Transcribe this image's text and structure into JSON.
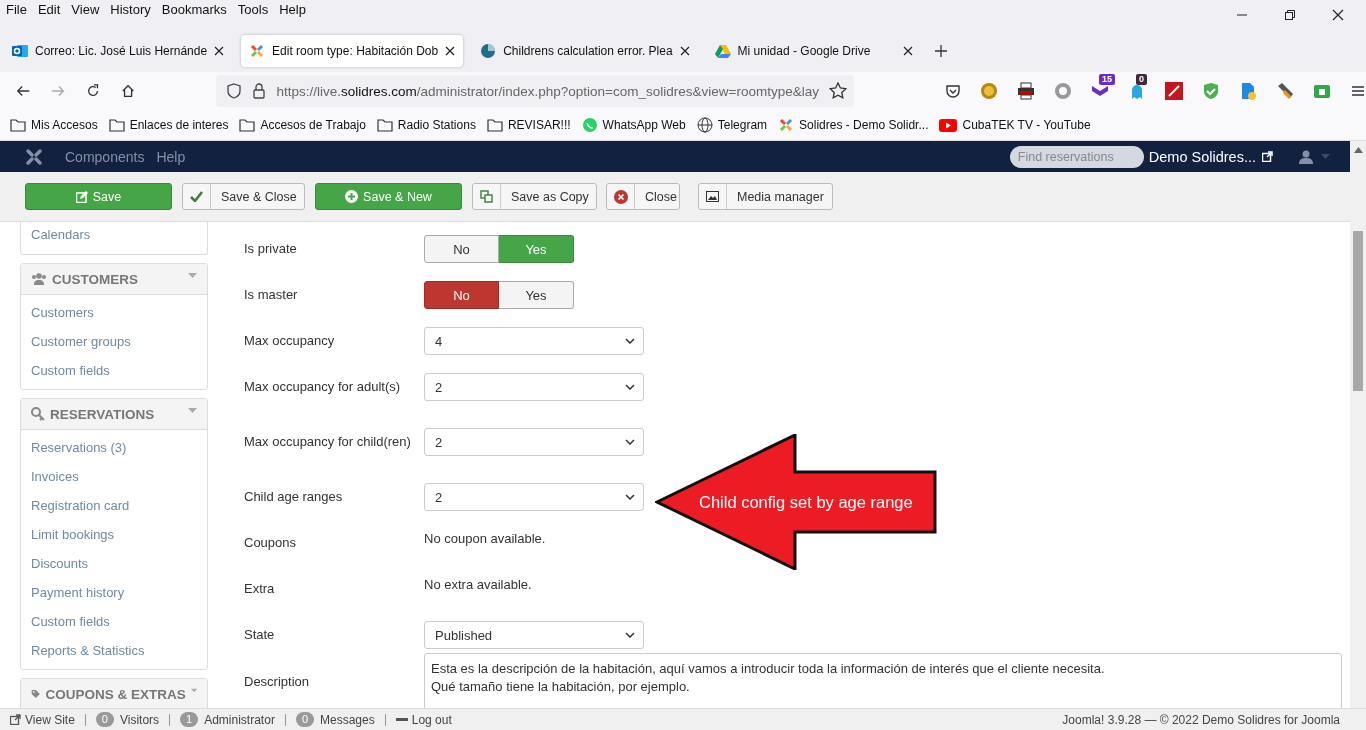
{
  "browser": {
    "menu": [
      "File",
      "Edit",
      "View",
      "History",
      "Bookmarks",
      "Tools",
      "Help"
    ],
    "tabs": [
      {
        "title": "Correo: Lic. José Luis Hernánde",
        "selected": false
      },
      {
        "title": "Edit room type: Habitación Dob",
        "selected": true
      },
      {
        "title": "Childrens calculation error. Plea",
        "selected": false
      },
      {
        "title": "Mi unidad - Google Drive",
        "selected": false
      }
    ],
    "url": {
      "prefix": "https://live.",
      "domain": "solidres.com",
      "rest": "/administrator/index.php?option=com_solidres&view=roomtype&lay"
    },
    "extension_badges": [
      "15",
      "0"
    ],
    "bookmarks": [
      "Mis Accesos",
      "Enlaces de interes",
      "Accesos de Trabajo",
      "Radio Stations",
      "REVISAR!!!",
      "WhatsApp Web",
      "Telegram",
      "Solidres - Demo Solidr...",
      "CubaTEK TV - YouTube"
    ]
  },
  "admin_nav": {
    "items": [
      "Components",
      "Help"
    ],
    "search": {
      "placeholder": "Find reservations"
    },
    "site": "Demo Solidres..."
  },
  "toolbar": [
    {
      "label": "Save",
      "kind": "primary"
    },
    {
      "label": "Save & Close",
      "kind": "default"
    },
    {
      "label": "Save & New",
      "kind": "primary"
    },
    {
      "label": "Save as Copy",
      "kind": "default"
    },
    {
      "label": "Close",
      "kind": "default"
    },
    {
      "label": "Media manager",
      "kind": "default"
    }
  ],
  "sidebar": {
    "top_items": [
      "Calendars"
    ],
    "sections": [
      {
        "title": "CUSTOMERS",
        "items": [
          "Customers",
          "Customer groups",
          "Custom fields"
        ]
      },
      {
        "title": "RESERVATIONS",
        "items": [
          "Reservations (3)",
          "Invoices",
          "Registration card",
          "Limit bookings",
          "Discounts",
          "Payment history",
          "Custom fields",
          "Reports & Statistics"
        ]
      },
      {
        "title": "COUPONS & EXTRAS"
      }
    ]
  },
  "form": [
    {
      "label": "Is private",
      "kind": "toggle",
      "options": [
        {
          "label": "No",
          "selected": false
        },
        {
          "label": "Yes",
          "selected": true
        }
      ]
    },
    {
      "label": "Is master",
      "kind": "toggle",
      "options": [
        {
          "label": "No",
          "selected": true
        },
        {
          "label": "Yes",
          "selected": false
        }
      ]
    },
    {
      "label": "Max occupancy",
      "kind": "select",
      "value": "4"
    },
    {
      "label": "Max occupancy for adult(s)",
      "kind": "select",
      "value": "2"
    },
    {
      "label": "Max occupancy for child(ren)",
      "kind": "select",
      "value": "2"
    },
    {
      "label": "Child age ranges",
      "kind": "select",
      "value": "2"
    },
    {
      "label": "Coupons",
      "kind": "text",
      "value": "No coupon available."
    },
    {
      "label": "Extra",
      "kind": "text",
      "value": "No extra available."
    },
    {
      "label": "State",
      "kind": "select",
      "value": "Published"
    },
    {
      "label": "Description",
      "kind": "textarea",
      "value": "Esta es la descripción de la habitación, aquí vamos a introducir toda la información de interés que el cliente necesita.\nQué tamaño tiene la habitación, por ejemplo."
    }
  ],
  "callout": "Child config set by age range",
  "status_bar": {
    "view_site": "View Site",
    "counters": [
      {
        "count": "0",
        "label": "Visitors"
      },
      {
        "count": "1",
        "label": "Administrator"
      },
      {
        "count": "0",
        "label": "Messages"
      }
    ],
    "logout": "Log out",
    "footer": "Joomla! 3.9.28 — © 2022 Demo Solidres for Joomla"
  }
}
